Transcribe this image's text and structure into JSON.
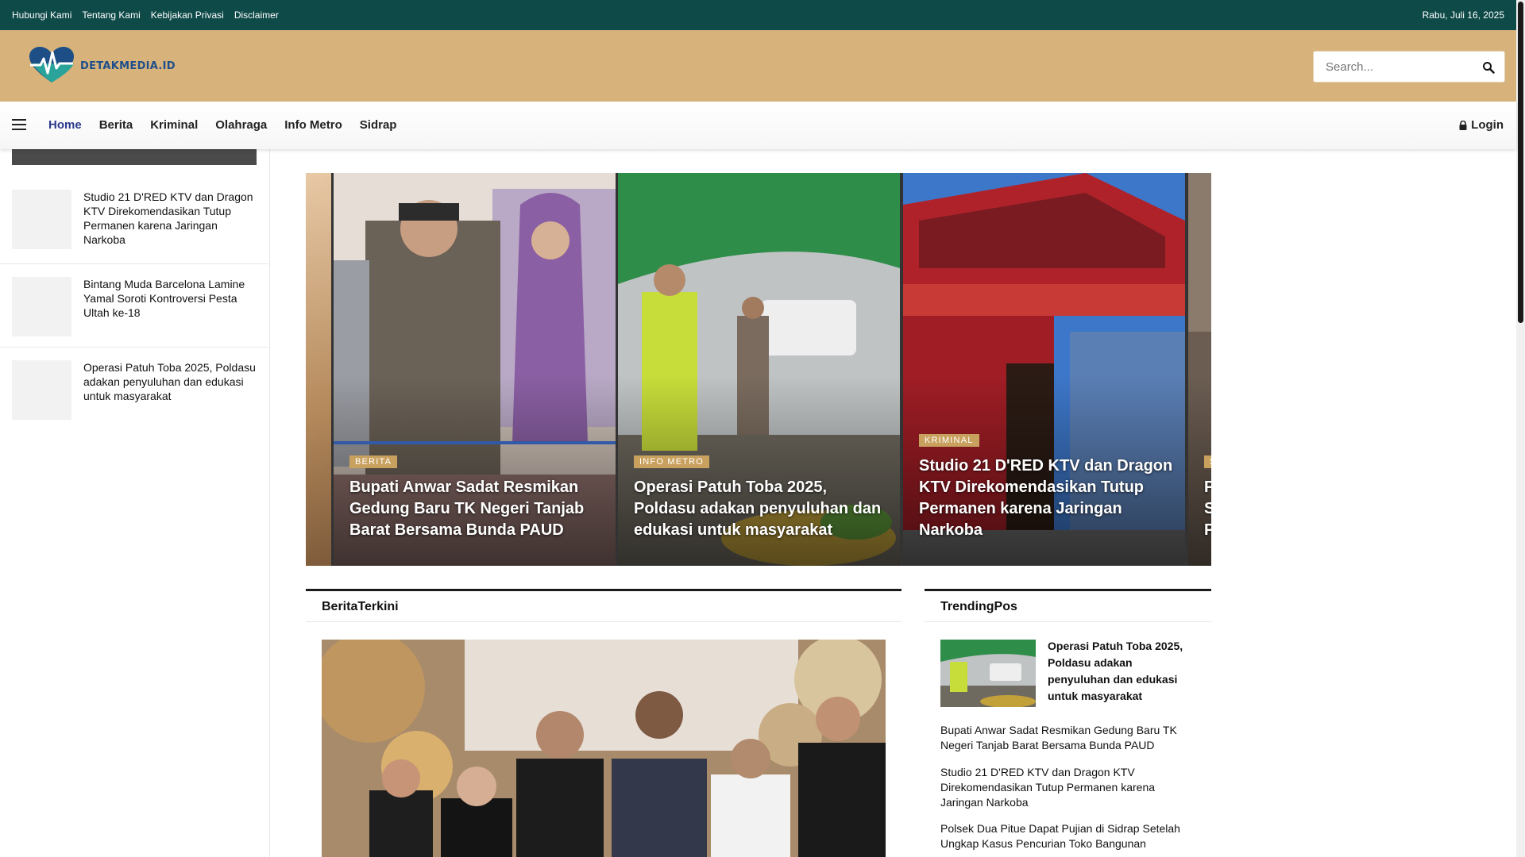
{
  "topbar": {
    "links": [
      "Hubungi Kami",
      "Tentang Kami",
      "Kebijakan Privasi",
      "Disclaimer"
    ],
    "date": "Rabu, Juli 16, 2025"
  },
  "header": {
    "logo_text": "DETAKMEDIA.ID",
    "search_placeholder": "Search..."
  },
  "nav": {
    "items": [
      "Home",
      "Berita",
      "Kriminal",
      "Olahraga",
      "Info Metro",
      "Sidrap"
    ],
    "active": "Home",
    "login": "Login"
  },
  "sidebar": {
    "items": [
      {
        "title": "Studio 21 D'RED KTV dan Dragon KTV Direkomendasikan Tutup Permanen karena Jaringan Narkoba"
      },
      {
        "title": "Bintang Muda Barcelona Lamine Yamal Soroti Kontroversi Pesta Ultah ke-18"
      },
      {
        "title": "Operasi Patuh Toba 2025, Poldasu adakan penyuluhan dan edukasi untuk masyarakat"
      }
    ]
  },
  "slider": {
    "slides": [
      {
        "category": "BERITA",
        "title": "Bupati Anwar Sadat Resmikan Gedung Baru TK Negeri Tanjab Barat Bersama Bunda PAUD"
      },
      {
        "category": "INFO METRO",
        "title": "Operasi Patuh Toba 2025, Poldasu adakan penyuluhan dan edukasi untuk masyarakat"
      },
      {
        "category": "KRIMINAL",
        "title": "Studio 21 D'RED KTV dan Dragon KTV Direkomendasikan Tutup Permanen karena Jaringan Narkoba"
      },
      {
        "category": "S",
        "title": "P S P"
      }
    ]
  },
  "berita_terkini": {
    "title": "BeritaTerkini"
  },
  "trending": {
    "title": "TrendingPos",
    "featured": "Operasi Patuh Toba 2025, Poldasu adakan penyuluhan dan edukasi untuk masyarakat",
    "items": [
      "Bupati Anwar Sadat Resmikan Gedung Baru TK Negeri Tanjab Barat Bersama Bunda PAUD",
      "Studio 21 D'RED KTV dan Dragon KTV Direkomendasikan Tutup Permanen karena Jaringan Narkoba",
      "Polsek Dua Pitue Dapat Pujian di Sidrap Setelah Ungkap Kasus Pencurian Toko Bangunan"
    ]
  },
  "colors": {
    "topbar": "#0e4a48",
    "header": "#d7b37b",
    "accent": "#c9a15f",
    "active_nav": "#2b3a8c"
  }
}
